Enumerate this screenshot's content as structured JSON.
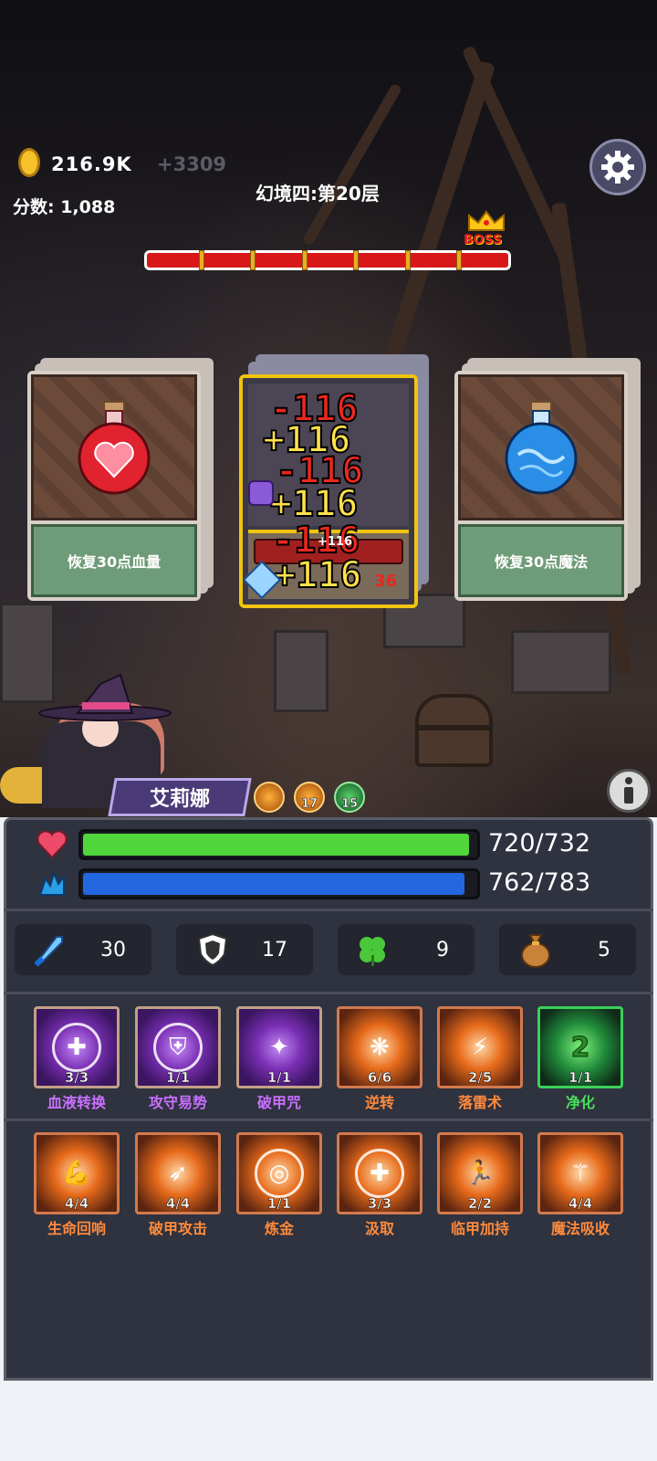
{
  "hud": {
    "gold": "216.9K",
    "gold_delta": "+3309",
    "score": "分数: 1,088",
    "level_title": "幻境四:第20层",
    "boss_label": "BOSS",
    "icons": {
      "coin": "coin-icon",
      "settings": "gear-icon",
      "boss": "crown-icon"
    }
  },
  "stage_progress": {
    "completed_fraction": 1.0,
    "segments": 7
  },
  "cards": [
    {
      "caption": "恢复30点血量",
      "icon": "red-heart-potion-icon",
      "color": "#e0232e"
    },
    {
      "caption": "",
      "icon": "enemy-card",
      "damage_popups": [
        "-116",
        "+116",
        "-116",
        "+116",
        "-116",
        "+116"
      ],
      "small_values": [
        "+116",
        "+116",
        "36"
      ]
    },
    {
      "caption": "恢复30点魔法",
      "icon": "blue-mana-potion-icon",
      "color": "#2a8ee6"
    }
  ],
  "character": {
    "name": "艾莉娜",
    "buffs": [
      {
        "icon": "person-buff-icon",
        "value": ""
      },
      {
        "icon": "shield-buff-icon",
        "value": "17"
      },
      {
        "icon": "arrow-up-buff-icon",
        "value": "15"
      }
    ]
  },
  "vitals": {
    "hp": {
      "text": "720/732",
      "fraction": 0.984,
      "color": "#4fd63a"
    },
    "mp": {
      "text": "762/783",
      "fraction": 0.973,
      "color": "#2266e0"
    }
  },
  "stats": [
    {
      "icon": "sword-icon",
      "value": "30"
    },
    {
      "icon": "shield-icon",
      "value": "17"
    },
    {
      "icon": "clover-icon",
      "value": "9"
    },
    {
      "icon": "money-bag-icon",
      "value": "5"
    }
  ],
  "skills_row1": [
    {
      "name": "血液转换",
      "count": "3/3",
      "style": "purple",
      "icon": "blood-drop-icon"
    },
    {
      "name": "攻守易势",
      "count": "1/1",
      "style": "purple",
      "icon": "crest-shield-icon"
    },
    {
      "name": "破甲咒",
      "count": "1/1",
      "style": "purple",
      "icon": "crystal-burst-icon"
    },
    {
      "name": "逆转",
      "count": "6/6",
      "style": "orange",
      "icon": "swirl-icon"
    },
    {
      "name": "落雷术",
      "count": "2/5",
      "style": "orange",
      "icon": "lightning-icon"
    },
    {
      "name": "净化",
      "count": "1/1",
      "style": "green",
      "icon": "purify-icon",
      "cooldown": "2"
    }
  ],
  "skills_row2": [
    {
      "name": "生命回响",
      "count": "4/4",
      "style": "orange",
      "icon": "flexed-arm-icon"
    },
    {
      "name": "破甲攻击",
      "count": "4/4",
      "style": "orange",
      "icon": "bow-icon"
    },
    {
      "name": "炼金",
      "count": "1/1",
      "style": "orange",
      "icon": "target-icon"
    },
    {
      "name": "汲取",
      "count": "3/3",
      "style": "orange",
      "icon": "heal-cross-icon"
    },
    {
      "name": "临甲加持",
      "count": "2/2",
      "style": "orange",
      "icon": "runner-icon"
    },
    {
      "name": "魔法吸收",
      "count": "4/4",
      "style": "orange",
      "icon": "winged-staff-icon"
    }
  ]
}
